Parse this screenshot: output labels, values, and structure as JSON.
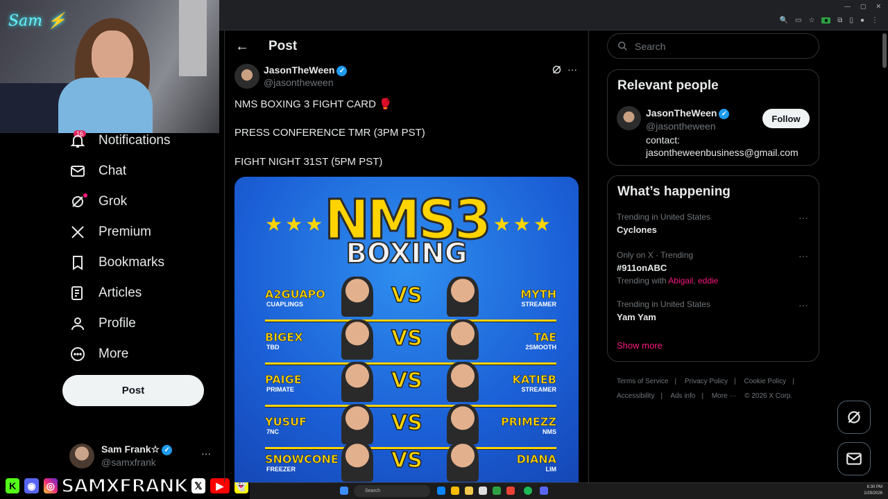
{
  "webcam": {
    "logo_text": "Sam ⚡"
  },
  "nav": {
    "badge": "16",
    "items": [
      {
        "label": "Notifications",
        "icon": "bell-icon"
      },
      {
        "label": "Chat",
        "icon": "mail-icon"
      },
      {
        "label": "Grok",
        "icon": "grok-icon"
      },
      {
        "label": "Premium",
        "icon": "x-logo-icon"
      },
      {
        "label": "Bookmarks",
        "icon": "bookmark-icon"
      },
      {
        "label": "Articles",
        "icon": "article-icon"
      },
      {
        "label": "Profile",
        "icon": "person-icon"
      },
      {
        "label": "More",
        "icon": "more-circle-icon"
      }
    ],
    "post_button": "Post"
  },
  "account": {
    "name": "Sam Frank☆",
    "handle": "@samxfrank",
    "more": "···"
  },
  "overlay": {
    "name": "SAMXFRANK"
  },
  "main": {
    "header_title": "Post",
    "back_icon": "←",
    "author": {
      "name": "JasonTheWeen",
      "handle": "@jasontheween"
    },
    "tweet_lines": [
      "NMS BOXING 3 FIGHT CARD 🥊",
      "PRESS CONFERENCE TMR (3PM PST)",
      "FIGHT NIGHT 31ST (5PM PST)"
    ],
    "poster": {
      "title_top": "NMS3",
      "title_bottom": "BOXING",
      "stars": "★★★",
      "fights": [
        {
          "left": "A2GUAPO",
          "left_sub": "CUAPLINGS",
          "vs": "VS",
          "right": "MYTH",
          "right_sub": "STREAMER"
        },
        {
          "left": "BIGEX",
          "left_sub": "TBD",
          "vs": "VS",
          "right": "TAE",
          "right_sub": "2SMOOTH"
        },
        {
          "left": "PAIGE",
          "left_sub": "PRIMATE",
          "vs": "VS",
          "right": "KATIEB",
          "right_sub": "STREAMER"
        },
        {
          "left": "YUSUF",
          "left_sub": "7NC",
          "vs": "VS",
          "right": "PRIMEZZ",
          "right_sub": "NMS"
        },
        {
          "left": "SNOWCONE",
          "left_sub": "FREEZER",
          "vs": "VS",
          "right": "DIANA",
          "right_sub": "LIM"
        }
      ]
    }
  },
  "right": {
    "search_placeholder": "Search",
    "relevant": {
      "title": "Relevant people",
      "name": "JasonTheWeen",
      "handle": "@jasontheween",
      "bio_1": "contact:",
      "bio_2": "jasontheweenbusiness@gmail.com",
      "follow": "Follow"
    },
    "happening": {
      "title": "What’s happening",
      "trends": [
        {
          "context": "Trending in United States",
          "topic": "Cyclones"
        },
        {
          "context": "Only on X · Trending",
          "topic": "#911onABC",
          "with_label": "Trending with",
          "with_1": "Abigail",
          "with_2": "eddie"
        },
        {
          "context": "Trending in United States",
          "topic": "Yam Yam"
        }
      ],
      "show_more": "Show more"
    },
    "footer": {
      "terms": "Terms of Service",
      "privacy": "Privacy Policy",
      "cookie": "Cookie Policy",
      "accessibility": "Accessibility",
      "ads": "Ads info",
      "more": "More ···",
      "copyright": "© 2026 X Corp."
    }
  },
  "taskbar": {
    "search": "Search",
    "time": "6:30 PM",
    "date": "1/29/2026"
  },
  "colors": {
    "accent": "#1d9bf0",
    "pink": "#f91880",
    "bg": "#000000",
    "poster_blue": "#1b5fd6",
    "poster_yellow": "#ffd400"
  }
}
